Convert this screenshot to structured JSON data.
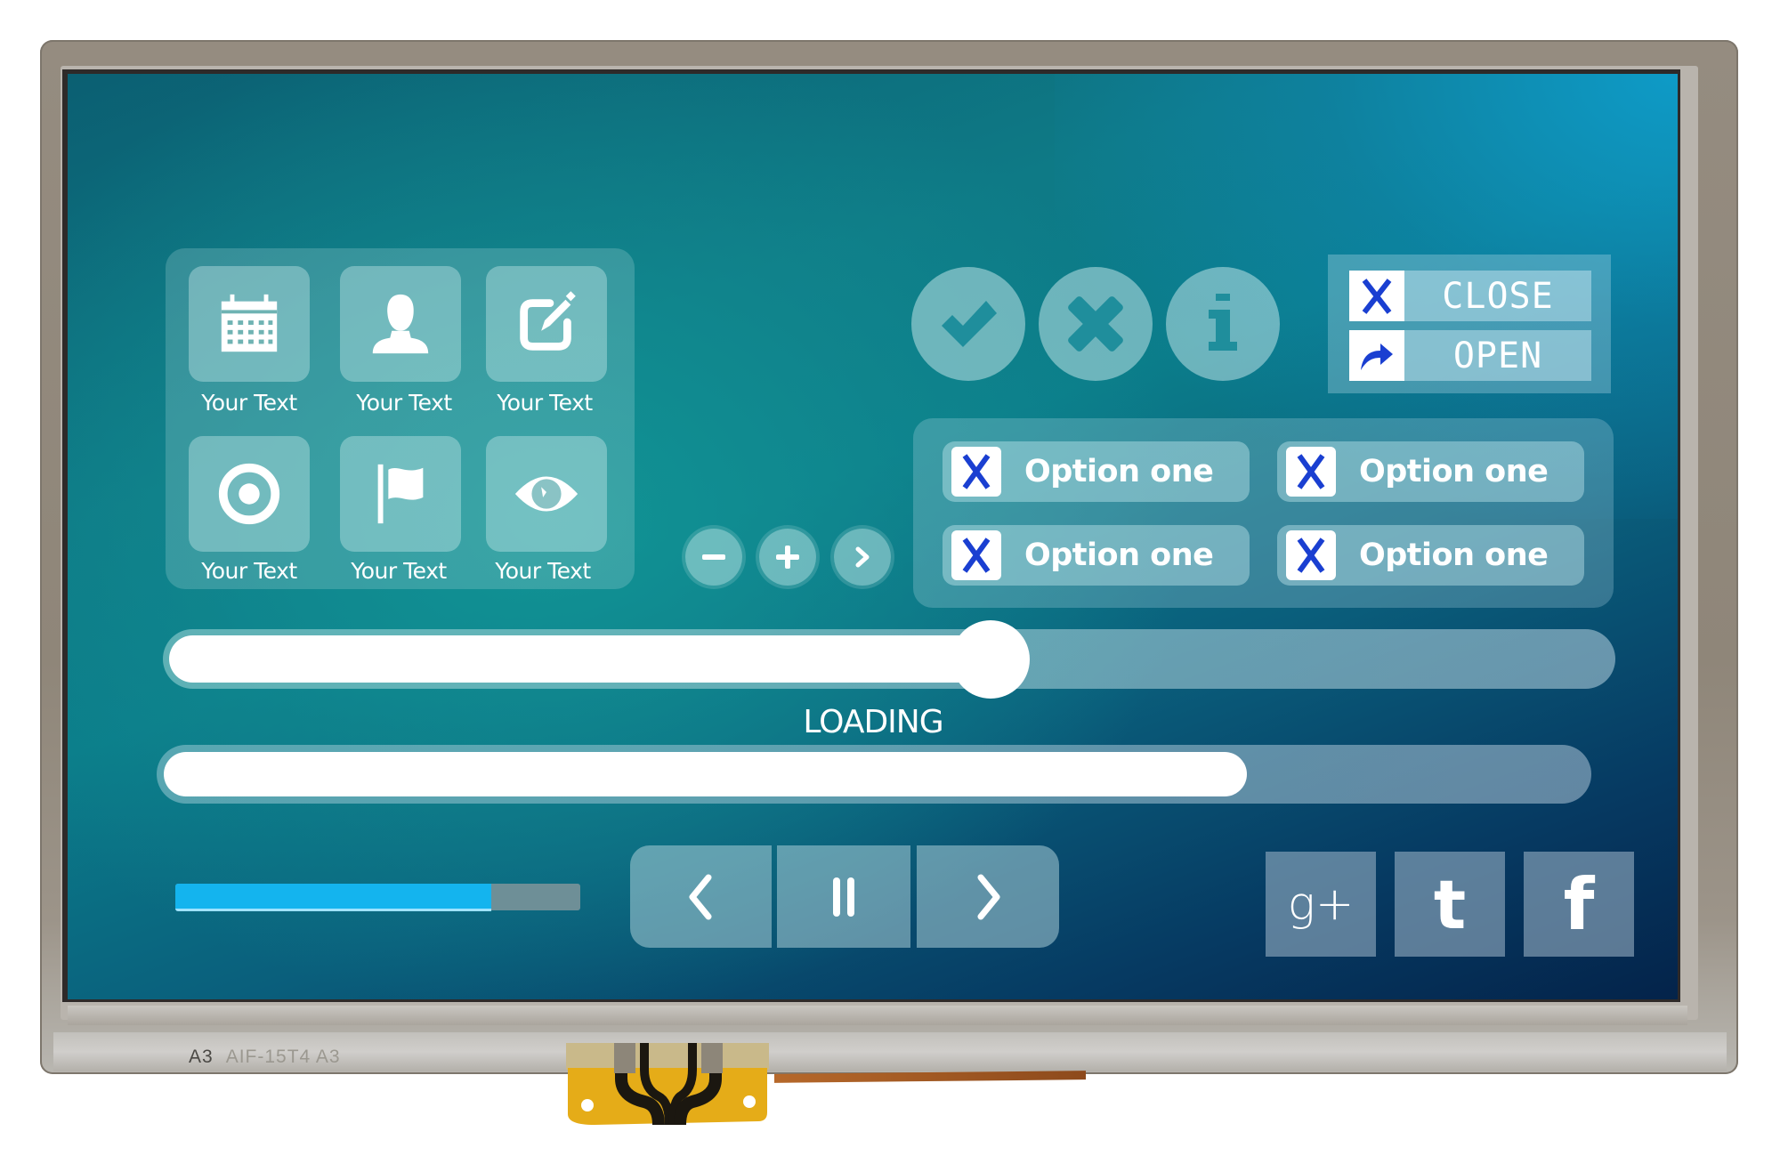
{
  "device": {
    "panel_label_main": "A3",
    "panel_label_faint": "AIF-15T4  A3"
  },
  "icon_grid": {
    "items": [
      {
        "icon": "calendar-icon",
        "label": "Your Text"
      },
      {
        "icon": "user-icon",
        "label": "Your Text"
      },
      {
        "icon": "edit-icon",
        "label": "Your Text"
      },
      {
        "icon": "target-icon",
        "label": "Your Text"
      },
      {
        "icon": "flag-icon",
        "label": "Your Text"
      },
      {
        "icon": "eye-icon",
        "label": "Your Text"
      }
    ]
  },
  "stepper": {
    "minus": "−",
    "plus": "+",
    "next": "›"
  },
  "status_buttons": [
    {
      "icon": "check-icon"
    },
    {
      "icon": "x-icon"
    },
    {
      "icon": "info-icon"
    }
  ],
  "close_open": {
    "close_label": "CLOSE",
    "open_label": "OPEN",
    "close_icon": "X",
    "accent": "#1a3fd1"
  },
  "options": [
    {
      "label": "Option one",
      "checked": true
    },
    {
      "label": "Option one",
      "checked": true
    },
    {
      "label": "Option one",
      "checked": true
    },
    {
      "label": "Option one",
      "checked": true
    }
  ],
  "slider": {
    "value": 0.57
  },
  "loading": {
    "label": "LOADING",
    "progress": 0.76
  },
  "mini_progress": {
    "progress": 0.78,
    "color": "#14b4ee"
  },
  "media": {
    "prev": "‹",
    "pause": "pause",
    "next": "›"
  },
  "social": [
    {
      "name": "google-plus",
      "glyph": "g+"
    },
    {
      "name": "tumblr",
      "glyph": "t"
    },
    {
      "name": "facebook",
      "glyph": "f"
    }
  ]
}
